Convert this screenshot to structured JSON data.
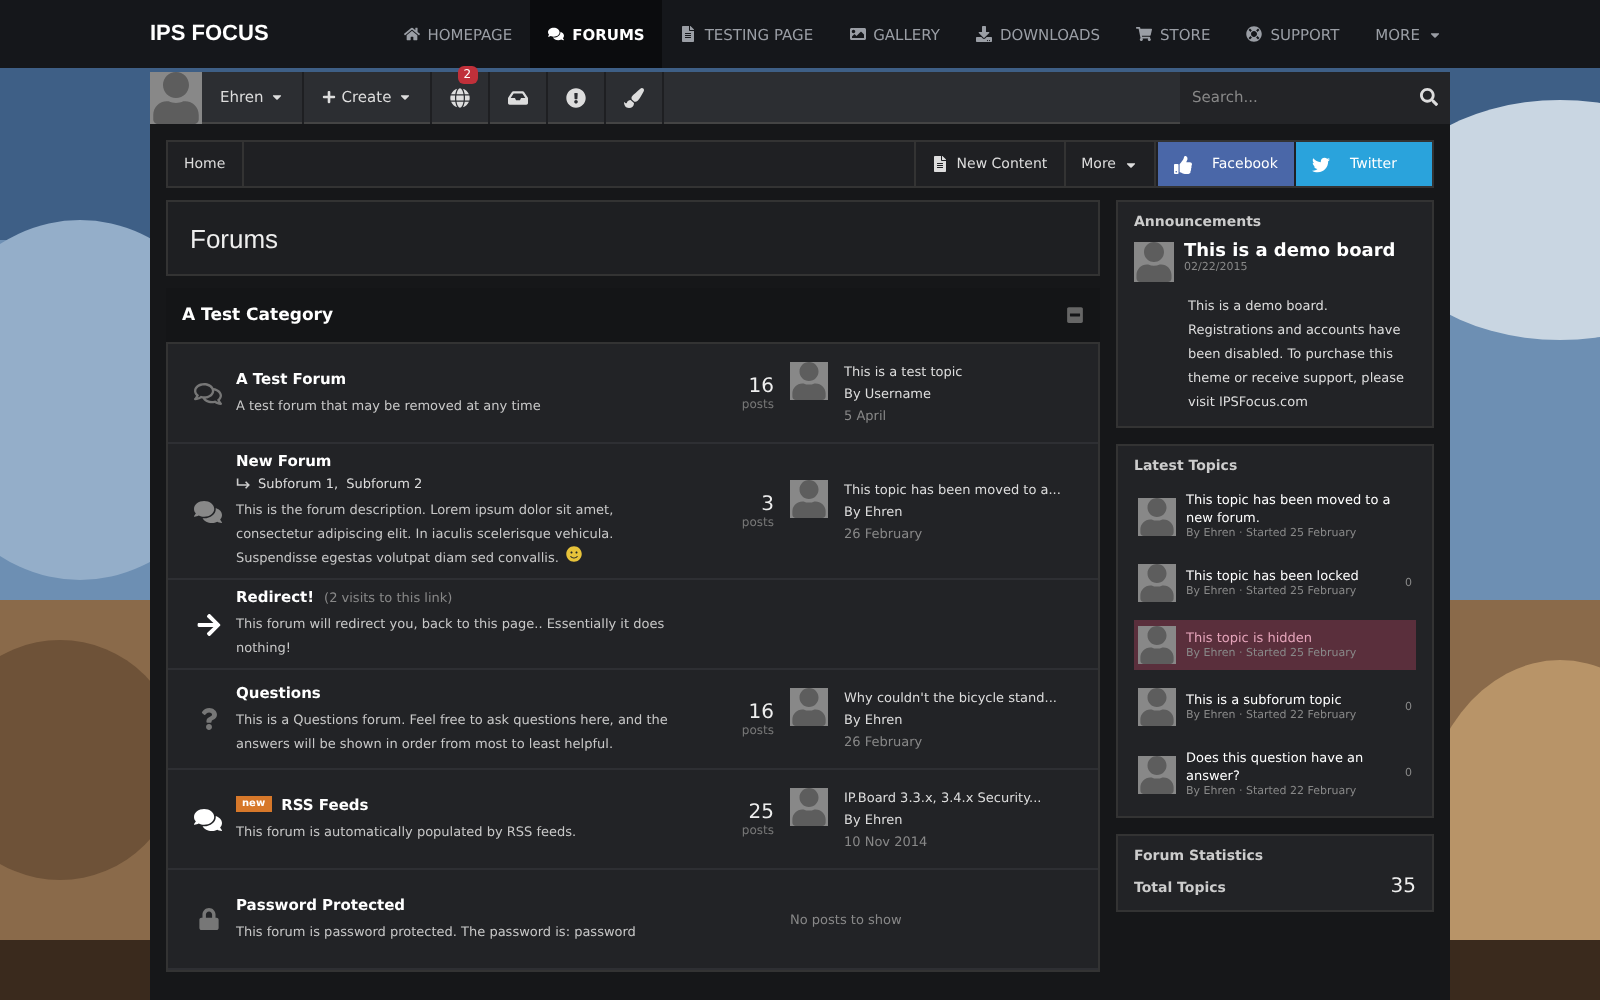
{
  "logo": "IPS FOCUS",
  "nav": [
    {
      "label": "HOMEPAGE",
      "selected": false,
      "dropdown": false
    },
    {
      "label": "FORUMS",
      "selected": true,
      "dropdown": false
    },
    {
      "label": "TESTING PAGE",
      "selected": false,
      "dropdown": false
    },
    {
      "label": "GALLERY",
      "selected": false,
      "dropdown": false
    },
    {
      "label": "DOWNLOADS",
      "selected": false,
      "dropdown": false
    },
    {
      "label": "STORE",
      "selected": false,
      "dropdown": false
    },
    {
      "label": "SUPPORT",
      "selected": false,
      "dropdown": false
    },
    {
      "label": "MORE",
      "selected": false,
      "dropdown": true
    }
  ],
  "user_bar": {
    "username": "Ehren",
    "create": "Create",
    "notification_count": "2",
    "search": {
      "placeholder": "Search..."
    }
  },
  "breadcrumb": {
    "home": "Home",
    "new_content": "New Content",
    "more": "More",
    "facebook": "Facebook",
    "twitter": "Twitter"
  },
  "page_title": "Forums",
  "category": {
    "title": "A Test Category",
    "expanded": true
  },
  "forums": [
    {
      "kind": "chat",
      "title": "A Test Forum",
      "description": "A test forum that may be removed at any time",
      "posts": "16",
      "posts_label": "posts",
      "last_topic": "This is a test topic",
      "last_by": "By Username",
      "last_date": "5 April"
    },
    {
      "kind": "multi",
      "title": "New Forum",
      "subforums": "Subforum 1,  Subforum 2",
      "description": "This is the forum description. Lorem ipsum dolor sit amet, consectetur adipiscing elit. In iaculis scelerisque vehicula. Suspendisse egestas volutpat diam sed convallis.",
      "emoji": true,
      "posts": "3",
      "posts_label": "posts",
      "last_topic": "This topic has been moved to a...",
      "last_by": "By Ehren",
      "last_date": "26 February"
    },
    {
      "kind": "redirect",
      "title": "Redirect!",
      "note": "(2 visits to this link)",
      "description": "This forum will redirect you, back to this page.. Essentially it does nothing!"
    },
    {
      "kind": "question",
      "title": "Questions",
      "description": "This is a Questions forum. Feel free to ask questions here, and the answers will be shown in order from most to least helpful.",
      "posts": "16",
      "posts_label": "posts",
      "last_topic": "Why couldn't the bicycle stand...",
      "last_by": "By Ehren",
      "last_date": "26 February"
    },
    {
      "kind": "rss",
      "badge": "new",
      "title": "RSS Feeds",
      "description": "This forum is automatically populated by RSS feeds.",
      "posts": "25",
      "posts_label": "posts",
      "last_topic": "IP.Board 3.3.x, 3.4.x Security...",
      "last_by": "By Ehren",
      "last_date": "10 Nov 2014"
    },
    {
      "kind": "lock",
      "title": "Password Protected",
      "description": "This forum is password protected. The password is: password",
      "no_posts": "No posts to show"
    }
  ],
  "announcements": {
    "heading": "Announcements",
    "title": "This is a demo board",
    "date": "02/22/2015",
    "body": "This is a demo board. Registrations and accounts have been disabled. To purchase this theme or receive support, please visit IPSFocus.com"
  },
  "latest_topics": {
    "heading": "Latest Topics",
    "items": [
      {
        "title": "This topic has been moved to a new forum.",
        "meta": "By Ehren · Started 25 February",
        "selected": false
      },
      {
        "title": "This topic has been locked",
        "meta": "By Ehren · Started 25 February",
        "replies": "0",
        "selected": false
      },
      {
        "title": "This topic is hidden",
        "meta": "By Ehren · Started 25 February",
        "selected": true
      },
      {
        "title": "This is a subforum topic",
        "meta": "By Ehren · Started 22 February",
        "replies": "0",
        "selected": false
      },
      {
        "title": "Does this question have an answer?",
        "meta": "By Ehren · Started 22 February",
        "replies": "0",
        "selected": false
      }
    ]
  },
  "forum_statistics": {
    "heading": "Forum Statistics",
    "label": "Total Topics",
    "value": "35"
  }
}
